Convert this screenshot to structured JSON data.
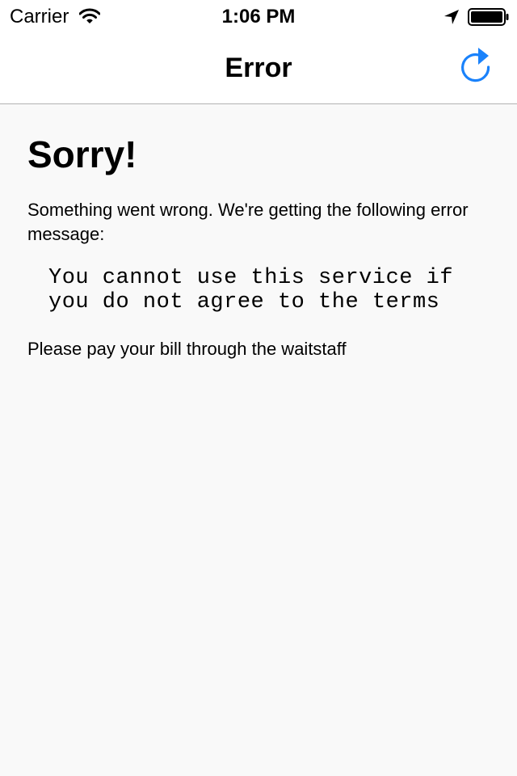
{
  "status_bar": {
    "carrier": "Carrier",
    "time": "1:06 PM",
    "icons": [
      "wifi-icon",
      "location-arrow-icon",
      "battery-icon"
    ]
  },
  "nav_bar": {
    "title": "Error",
    "refresh_icon": "refresh-icon",
    "accent_color": "#1a82fb"
  },
  "content": {
    "heading": "Sorry!",
    "intro": "Something went wrong. We're getting the following error message:",
    "error_message": "You cannot use this service if you do not agree to the terms",
    "footer_note": "Please pay your bill through the waitstaff"
  },
  "colors": {
    "background": "#f9f9f9",
    "bar_background": "#ffffff",
    "divider": "#b2b2b2",
    "text": "#000000"
  }
}
